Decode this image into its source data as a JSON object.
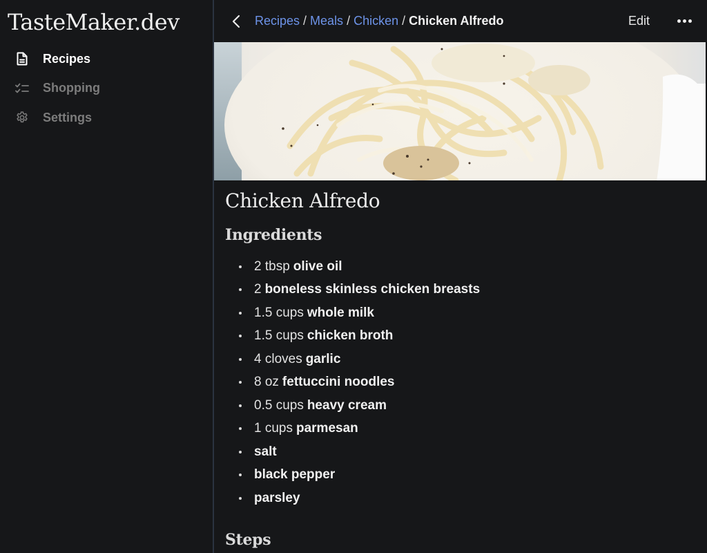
{
  "app": {
    "brand": "TasteMaker.dev"
  },
  "sidebar": {
    "items": [
      {
        "label": "Recipes",
        "icon": "document-icon",
        "active": true
      },
      {
        "label": "Shopping",
        "icon": "checklist-icon",
        "active": false
      },
      {
        "label": "Settings",
        "icon": "gear-icon",
        "active": false
      }
    ]
  },
  "header": {
    "breadcrumb": [
      {
        "label": "Recipes",
        "link": true
      },
      {
        "label": "Meals",
        "link": true
      },
      {
        "label": "Chicken",
        "link": true
      },
      {
        "label": "Chicken Alfredo",
        "link": false
      }
    ],
    "separator": "/",
    "edit_label": "Edit",
    "more_icon": "more-horizontal-icon",
    "back_icon": "chevron-left-icon"
  },
  "recipe": {
    "image_alt": "Chicken Alfredo fettuccine in a white bowl",
    "title": "Chicken Alfredo",
    "ingredients_heading": "Ingredients",
    "ingredients": [
      {
        "qty": "2 tbsp",
        "name": "olive oil"
      },
      {
        "qty": "2",
        "name": "boneless skinless chicken breasts"
      },
      {
        "qty": "1.5 cups",
        "name": "whole milk"
      },
      {
        "qty": "1.5 cups",
        "name": "chicken broth"
      },
      {
        "qty": "4 cloves",
        "name": "garlic"
      },
      {
        "qty": "8 oz",
        "name": "fettuccini noodles"
      },
      {
        "qty": "0.5 cups",
        "name": "heavy cream"
      },
      {
        "qty": "1 cups",
        "name": "parmesan"
      },
      {
        "qty": "",
        "name": "salt"
      },
      {
        "qty": "",
        "name": "black pepper"
      },
      {
        "qty": "",
        "name": "parsley"
      }
    ],
    "steps_heading": "Steps"
  },
  "colors": {
    "background": "#161719",
    "link": "#6d93e8",
    "divider": "#2b3340"
  }
}
